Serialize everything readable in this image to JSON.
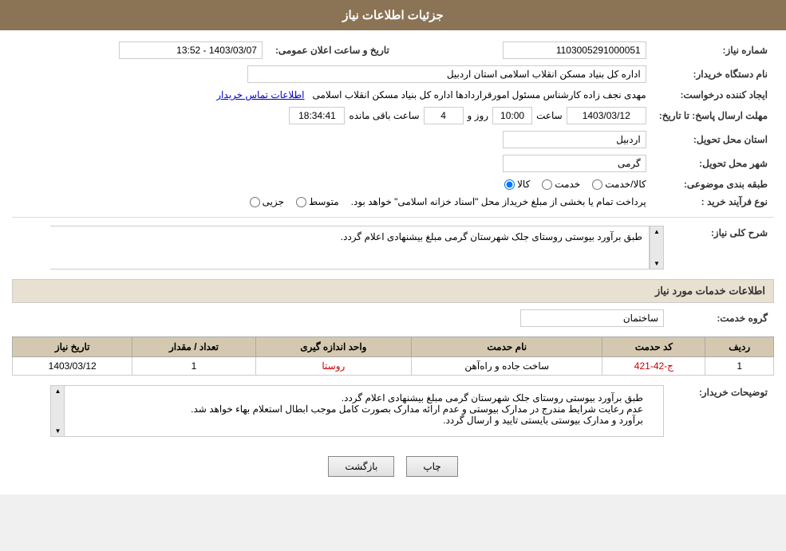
{
  "header": {
    "title": "جزئیات اطلاعات نیاز"
  },
  "fields": {
    "need_number_label": "شماره نیاز:",
    "need_number_value": "1103005291000051",
    "org_name_label": "نام دستگاه خریدار:",
    "org_name_value": "اداره کل بنیاد مسکن انقلاب اسلامی استان اردبیل",
    "creator_label": "ایجاد کننده درخواست:",
    "creator_value": "مهدی نجف زاده کارشناس مسئول امورقراردادها اداره کل بنیاد مسکن انقلاب اسلامی",
    "creator_link": "اطلاعات تماس خریدار",
    "deadline_label": "مهلت ارسال پاسخ: تا تاریخ:",
    "deadline_date": "1403/03/12",
    "deadline_time_label": "ساعت",
    "deadline_time": "10:00",
    "deadline_day_label": "روز و",
    "deadline_day": "4",
    "deadline_remaining_label": "ساعت باقی مانده",
    "deadline_remaining": "18:34:41",
    "province_label": "استان محل تحویل:",
    "province_value": "اردبیل",
    "city_label": "شهر محل تحویل:",
    "city_value": "گرمی",
    "publish_label": "تاریخ و ساعت اعلان عمومی:",
    "publish_value": "1403/03/07 - 13:52",
    "category_label": "طبقه بندی موضوعی:",
    "category_options": [
      "کالا",
      "خدمت",
      "کالا/خدمت"
    ],
    "category_selected": "کالا",
    "purchase_type_label": "نوع فرآیند خرید :",
    "purchase_type_options": [
      "جزیی",
      "متوسط"
    ],
    "purchase_type_note": "پرداخت تمام یا بخشی از مبلغ خریداز محل \"اسناد خزانه اسلامی\" خواهد بود.",
    "description_label": "شرح کلی نیاز:",
    "description_value": "طبق برآورد بیوستی روستای جلک شهرستان گرمی مبلغ بیشنهادی اعلام گردد.",
    "services_label": "اطلاعات خدمات مورد نیاز",
    "service_group_label": "گروه خدمت:",
    "service_group_value": "ساختمان",
    "table": {
      "headers": [
        "ردیف",
        "کد حدمت",
        "نام حدمت",
        "واحد اندازه گیری",
        "تعداد / مقدار",
        "تاریخ نیاز"
      ],
      "rows": [
        {
          "row": "1",
          "code": "ج-42-421",
          "name": "ساخت جاده و راه‌آهن",
          "unit": "روستا",
          "quantity": "1",
          "date": "1403/03/12"
        }
      ]
    },
    "buyer_comment_label": "توضیحات خریدار:",
    "buyer_comment_value": "طبق برآورد بیوستی روستای جلک شهرستان گرمی مبلغ بیشنهادی اعلام گردد.\nعدم رعایت شرایط مندرج در مدارک بیوستی و عدم ارائه مدارک بصورت کامل موجب ابطال استعلام بهاء خواهد شد.\nبرآورد و مدارک بیوستی بایستی تایید و ارسال گردد."
  },
  "buttons": {
    "back": "بازگشت",
    "print": "چاپ"
  }
}
